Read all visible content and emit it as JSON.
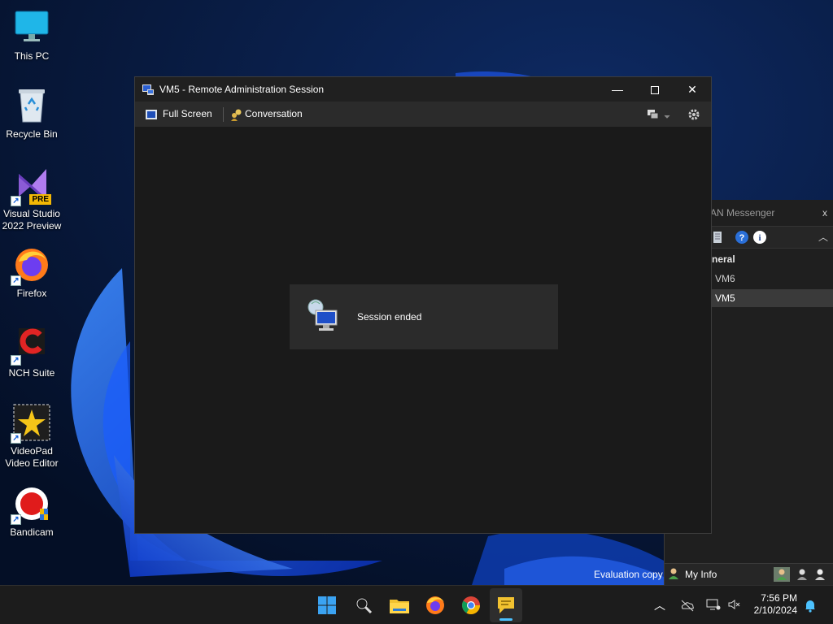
{
  "desktop": {
    "icons": [
      {
        "label": "This PC",
        "icon": "monitor-icon"
      },
      {
        "label": "Recycle Bin",
        "icon": "recycle-bin-icon"
      },
      {
        "label": "Visual Studio 2022 Preview",
        "icon": "visual-studio-icon",
        "badge": "PRE"
      },
      {
        "label": "Firefox",
        "icon": "firefox-icon"
      },
      {
        "label": "NCH Suite",
        "icon": "nch-suite-icon"
      },
      {
        "label": "VideoPad Video Editor",
        "icon": "videopad-icon"
      },
      {
        "label": "Bandicam",
        "icon": "bandicam-icon"
      }
    ]
  },
  "rdp_window": {
    "title": "VM5 - Remote Administration Session",
    "toolbar": {
      "fullscreen_label": "Full Screen",
      "conversation_label": "Conversation"
    },
    "status_message": "Session ended"
  },
  "messenger": {
    "title": "AN Messenger",
    "close_label": "x",
    "group_name": "neral",
    "contacts": [
      "VM6",
      "VM5"
    ],
    "footer": {
      "evaluation_text": "Evaluation copy",
      "my_info_label": "My Info"
    }
  },
  "taskbar": {
    "time": "7:56 PM",
    "date": "2/10/2024",
    "apps": [
      "start-icon",
      "search-icon",
      "file-explorer-icon",
      "firefox-icon",
      "chrome-icon",
      "messenger-icon"
    ]
  },
  "colors": {
    "window_bg": "#1c1c1c",
    "toolbar_bg": "#2b2b2b",
    "accent": "#4cc2ff",
    "wallpaper": "#071a3d"
  }
}
